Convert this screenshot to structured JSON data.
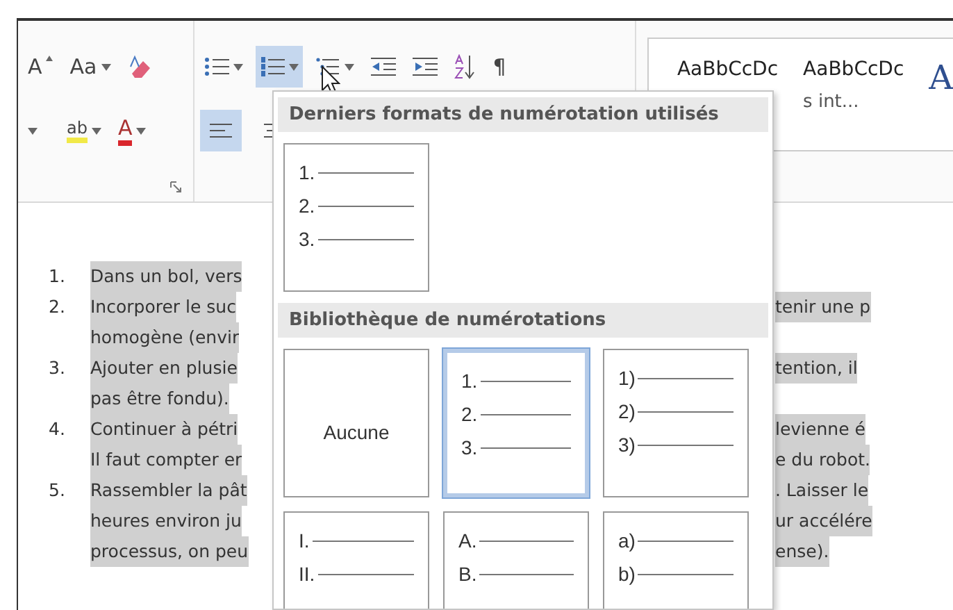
{
  "font_group": {
    "grow_label": "A",
    "case_label": "Aa",
    "highlight_label": "ab",
    "color_label": "A"
  },
  "paragraph_group": {
    "buttons": [
      {
        "kind": "bullets",
        "selected": false
      },
      {
        "kind": "numbering",
        "selected": true
      },
      {
        "kind": "multilevel",
        "selected": false
      },
      {
        "kind": "outdent",
        "selected": false
      },
      {
        "kind": "indent",
        "selected": false
      },
      {
        "kind": "sort",
        "selected": false
      },
      {
        "kind": "pilcrow",
        "label": "¶",
        "selected": false
      }
    ],
    "align": [
      {
        "kind": "left",
        "selected": true
      },
      {
        "kind": "center",
        "selected": false
      }
    ]
  },
  "styles": [
    {
      "sample": "AaBbCcDc"
    },
    {
      "sample": "AaBbCcDc",
      "name": "s int..."
    },
    {
      "sample": "A"
    }
  ],
  "document": {
    "items": [
      {
        "number": "1.",
        "lines": [
          {
            "left": "Dans un bol, vers"
          }
        ]
      },
      {
        "number": "2.",
        "lines": [
          {
            "left": "Incorporer le suc",
            "right": "tenir une p"
          },
          {
            "left": "homogène (envir"
          }
        ]
      },
      {
        "number": "3.",
        "lines": [
          {
            "left": "Ajouter en plusie",
            "right": "tention, il"
          },
          {
            "left": "pas être fondu)."
          }
        ]
      },
      {
        "number": "4.",
        "lines": [
          {
            "left": "Continuer à pétri",
            "right": "levienne é"
          },
          {
            "left": "Il faut compter er",
            "right": "e du robot."
          }
        ]
      },
      {
        "number": "5.",
        "lines": [
          {
            "left": "Rassembler la pât",
            "right": ". Laisser le"
          },
          {
            "left": "heures environ ju",
            "right": "ur accélére"
          },
          {
            "left": "processus, on peu",
            "right": "ense)."
          }
        ]
      }
    ]
  },
  "numbering_menu": {
    "sections": [
      {
        "title": "Derniers formats de numérotation utilisés",
        "items": [
          {
            "kind": "list",
            "markers": [
              "1.",
              "2.",
              "3."
            ],
            "selected": false
          }
        ]
      },
      {
        "title": "Bibliothèque de numérotations",
        "items": [
          {
            "kind": "none",
            "label": "Aucune",
            "selected": false
          },
          {
            "kind": "list",
            "markers": [
              "1.",
              "2.",
              "3."
            ],
            "selected": true
          },
          {
            "kind": "list",
            "markers": [
              "1)",
              "2)",
              "3)"
            ],
            "selected": false
          },
          {
            "kind": "list",
            "markers": [
              "I.",
              "II."
            ],
            "selected": false
          },
          {
            "kind": "list",
            "markers": [
              "A.",
              "B."
            ],
            "selected": false
          },
          {
            "kind": "list",
            "markers": [
              "a)",
              "b)"
            ],
            "selected": false
          }
        ]
      }
    ]
  }
}
